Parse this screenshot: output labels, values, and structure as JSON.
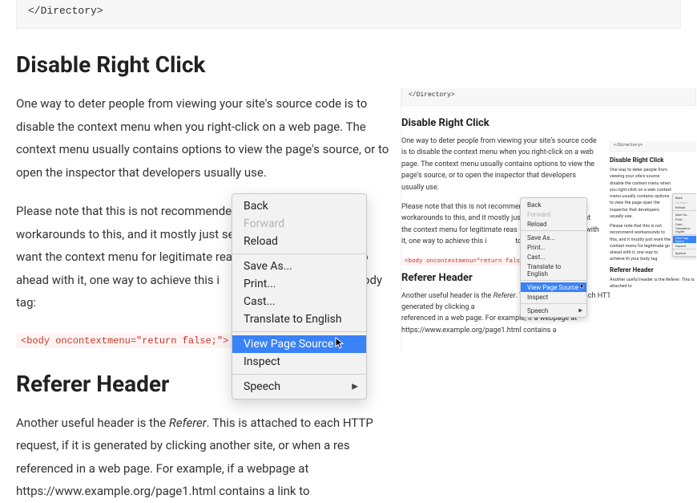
{
  "codeblock_tail": "  </Directory>",
  "h_disable": "Disable Right Click",
  "p_disable_1": "One way to deter people from viewing your site's source code is to disable the context menu when you right-click on a web page. The context menu usually contains options to view the page's source, or to open the inspector that developers usually use.",
  "p_disable_2a": "Please note that this is not recommended",
  "p_disable_2b": "ple workarounds to this, and it mostly just se",
  "p_disable_2c": "ight want the context menu for legitimate reas",
  "p_disable_2d": "to go ahead with it, one way to achieve this i",
  "p_disable_2e": "to your body tag:",
  "code_body": "<body oncontextmenu=\"return false;\">",
  "h_referer": "Referer Header",
  "p_referer_a": "Another useful header is the ",
  "p_referer_italic": "Referer",
  "p_referer_b": ". This is attached to each HTTP request, if it is generated by clicking another site, or when a res",
  "p_referer_c": "referenced in a web page. For example, if a webpage at https://www.example.org/page1.html contains a link to",
  "ctx": {
    "back": "Back",
    "forward": "Forward",
    "reload": "Reload",
    "saveas": "Save As...",
    "print": "Print...",
    "cast": "Cast...",
    "translate": "Translate to English",
    "view_source": "View Page Source",
    "inspect": "Inspect",
    "speech": "Speech"
  },
  "thumb": {
    "p_referer_a": "Another useful header is the ",
    "p_referer_b": ". This is attached to each HTTP request, if it is generated by clicking a",
    "p_referer_c": "referenced in a web page. For example, if a webpage at https://www.example.org/page1.html contains a"
  },
  "thumb2": {
    "p1": "One way to deter people from viewing your site's source",
    "p2": "disable the context menu when you right-click on a web",
    "p3": "context menu usually contains options to view the page",
    "p4": "open the inspector that developers usually use.",
    "q1": "Please note that this is not recommend",
    "q2": "workarounds to this, and it mostly just",
    "q3": "want the context menu for legitimate",
    "q4": "go ahead with it, one way to achieve th",
    "q5": "your body tag:",
    "ref_b": ". This is attached to"
  }
}
